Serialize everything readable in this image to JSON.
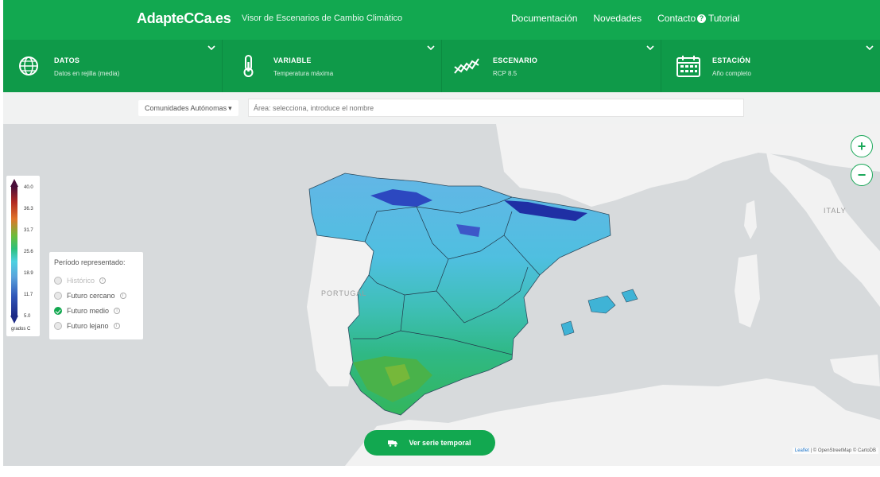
{
  "header": {
    "logo": "AdapteCCa.es",
    "subtitle": "Visor de Escenarios de Cambio Climático",
    "nav": [
      "Documentación",
      "Novedades",
      "Contacto"
    ],
    "tutorial": "Tutorial"
  },
  "selectors": [
    {
      "title": "DATOS",
      "value": "Datos en rejilla (media)",
      "icon": "globe-icon"
    },
    {
      "title": "VARIABLE",
      "value": "Temperatura máxima",
      "icon": "thermometer-icon"
    },
    {
      "title": "ESCENARIO",
      "value": "RCP 8.5",
      "icon": "trend-chart-icon"
    },
    {
      "title": "ESTACIÓN",
      "value": "Año completo",
      "icon": "calendar-icon"
    }
  ],
  "search": {
    "region_dropdown": "Comunidades Autónomas",
    "placeholder": "Área: selecciona, introduce el nombre"
  },
  "map": {
    "label_portugal": "PORTUGAL",
    "label_italy": "ITALY",
    "zoom_in": "+",
    "zoom_out": "−",
    "attribution_leaflet": "Leaflet",
    "attribution_rest": " | © OpenStreetMap © CartoDB"
  },
  "legend": {
    "ticks": [
      "40.0",
      "36.3",
      "31.7",
      "25.6",
      "18.9",
      "11.7",
      "5.0"
    ],
    "unit": "grados C",
    "colors": [
      "#4a0f3a",
      "#b22a22",
      "#e0752a",
      "#6cbd3b",
      "#2dc07a",
      "#4dd0e1",
      "#5aa3dc",
      "#3056b8",
      "#1c2a86"
    ]
  },
  "period": {
    "title": "Período representado:",
    "options": [
      {
        "label": "Histórico",
        "selected": false,
        "disabled": true
      },
      {
        "label": "Futuro cercano",
        "selected": false,
        "disabled": false
      },
      {
        "label": "Futuro medio",
        "selected": true,
        "disabled": false
      },
      {
        "label": "Futuro lejano",
        "selected": false,
        "disabled": false
      }
    ]
  },
  "series_button": "Ver serie temporal",
  "colors": {
    "brand": "#12a850",
    "brand_dark": "#0f9a49"
  }
}
